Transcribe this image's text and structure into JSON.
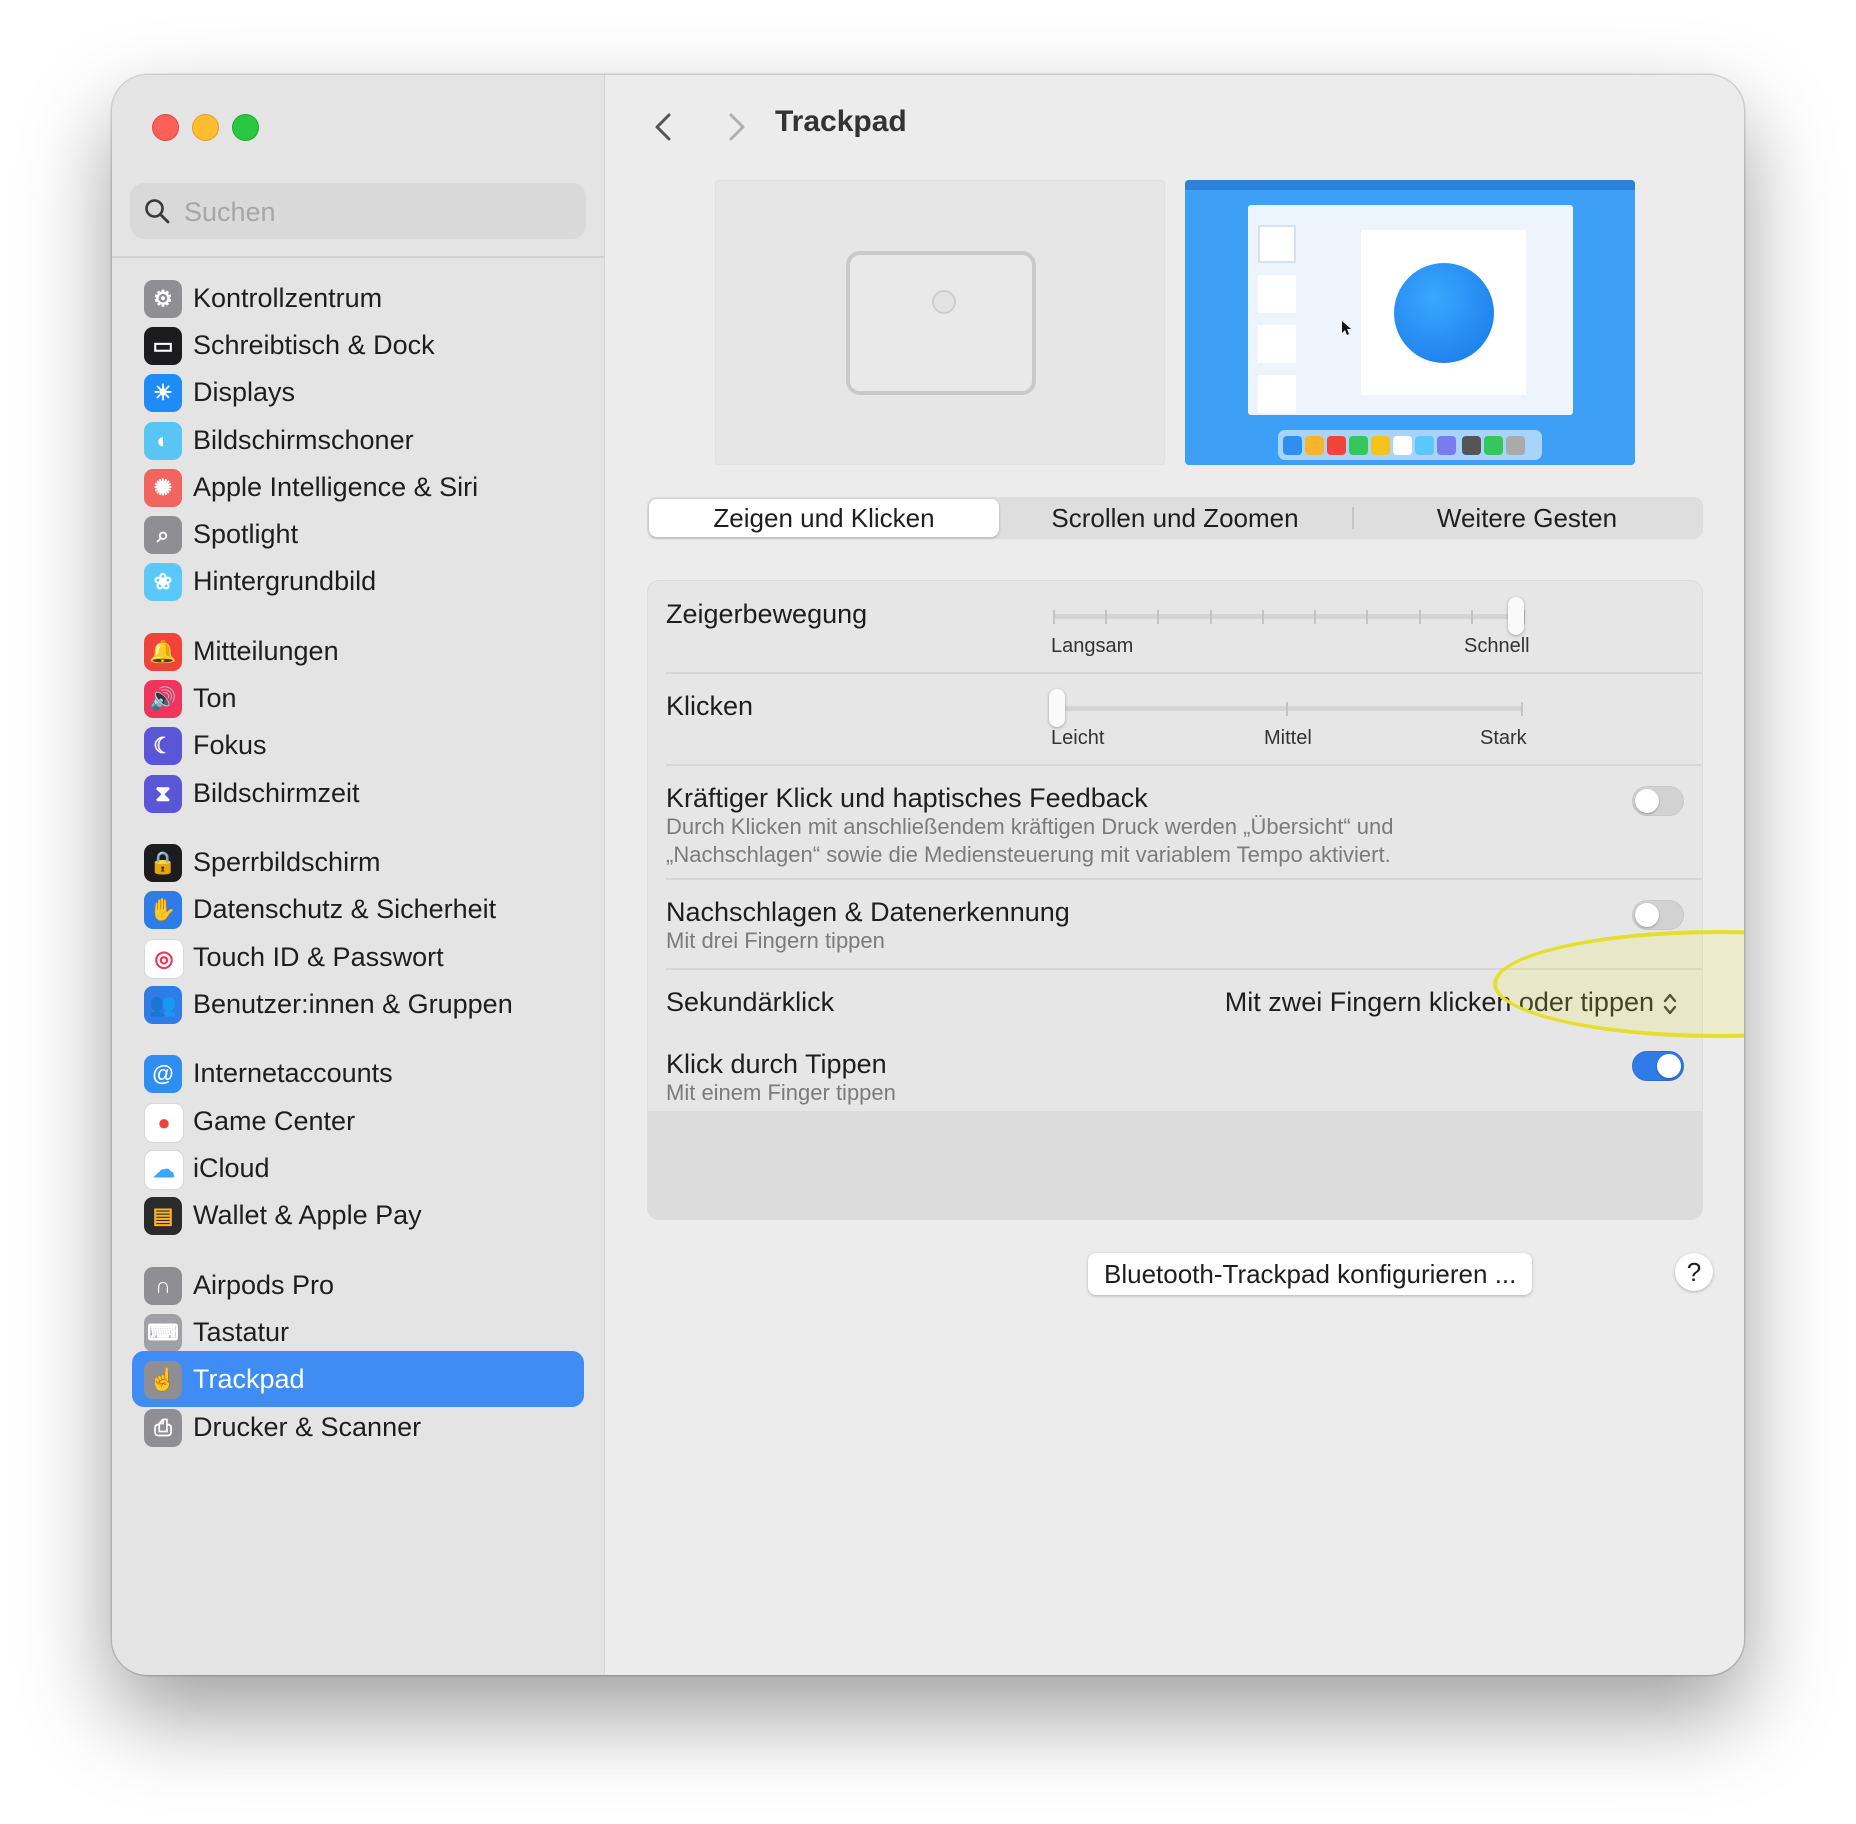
{
  "window": {
    "title": "Trackpad"
  },
  "search": {
    "placeholder": "Suchen",
    "value": ""
  },
  "sidebar": {
    "items": [
      {
        "label": "Kontrollzentrum",
        "icon": "control-center-icon",
        "color": "#8e8e93"
      },
      {
        "label": "Schreibtisch & Dock",
        "icon": "desktop-dock-icon",
        "color": "#1c1c1e"
      },
      {
        "label": "Displays",
        "icon": "displays-icon",
        "color": "#1e8bf7"
      },
      {
        "label": "Bildschirmschoner",
        "icon": "screensaver-icon",
        "color": "#58c5f5"
      },
      {
        "label": "Apple Intelligence & Siri",
        "icon": "siri-icon",
        "color": "#f2655f"
      },
      {
        "label": "Spotlight",
        "icon": "spotlight-icon",
        "color": "#8e8e93"
      },
      {
        "label": "Hintergrundbild",
        "icon": "wallpaper-icon",
        "color": "#5ac8fa"
      },
      {
        "label": "Mitteilungen",
        "icon": "notifications-icon",
        "color": "#f0443a"
      },
      {
        "label": "Ton",
        "icon": "sound-icon",
        "color": "#f0355c"
      },
      {
        "label": "Fokus",
        "icon": "focus-icon",
        "color": "#5a56d6"
      },
      {
        "label": "Bildschirmzeit",
        "icon": "screen-time-icon",
        "color": "#5a56d6"
      },
      {
        "label": "Sperrbildschirm",
        "icon": "lock-screen-icon",
        "color": "#1c1c1e"
      },
      {
        "label": "Datenschutz & Sicherheit",
        "icon": "privacy-hand-icon",
        "color": "#2f7ce8"
      },
      {
        "label": "Touch ID & Passwort",
        "icon": "fingerprint-icon",
        "color": "#ffffff"
      },
      {
        "label": "Benutzer:innen & Gruppen",
        "icon": "users-icon",
        "color": "#2f7ce8"
      },
      {
        "label": "Internetaccounts",
        "icon": "at-icon",
        "color": "#2f8ef0"
      },
      {
        "label": "Game Center",
        "icon": "game-center-icon",
        "color": "#ffffff"
      },
      {
        "label": "iCloud",
        "icon": "icloud-icon",
        "color": "#ffffff"
      },
      {
        "label": "Wallet & Apple Pay",
        "icon": "wallet-icon",
        "color": "#2b2b2b"
      },
      {
        "label": "Airpods Pro",
        "icon": "airpods-icon",
        "color": "#8e8e93"
      },
      {
        "label": "Tastatur",
        "icon": "keyboard-icon",
        "color": "#a0a0a5"
      },
      {
        "label": "Trackpad",
        "icon": "trackpad-icon",
        "color": "#8e8e93",
        "selected": true
      },
      {
        "label": "Drucker & Scanner",
        "icon": "printer-icon",
        "color": "#8e8e93"
      }
    ]
  },
  "tabs": [
    "Zeigen und Klicken",
    "Scrollen und Zoomen",
    "Weitere Gesten"
  ],
  "active_tab": "Zeigen und Klicken",
  "settings": {
    "pointer_speed": {
      "title": "Zeigerbewegung",
      "min_label": "Langsam",
      "max_label": "Schnell",
      "value_fraction": 1.0,
      "steps": 10
    },
    "click_force": {
      "title": "Klicken",
      "labels": [
        "Leicht",
        "Mittel",
        "Stark"
      ],
      "value_fraction": 0.0
    },
    "force_click": {
      "title": "Kräftiger Klick und haptisches Feedback",
      "sub_line1": "Durch Klicken mit anschließendem kräftigen Druck werden „Übersicht“ und",
      "sub_line2": "„Nachschlagen“ sowie die Mediensteuerung mit variablem Tempo aktiviert.",
      "enabled": false
    },
    "lookup": {
      "title": "Nachschlagen & Datenerkennung",
      "subtitle": "Mit drei Fingern tippen",
      "enabled": false
    },
    "secondary_click": {
      "title": "Sekundärklick",
      "value": "Mit zwei Fingern klicken oder tippen"
    },
    "tap_to_click": {
      "title": "Klick durch Tippen",
      "subtitle": "Mit einem Finger tippen",
      "enabled": true
    }
  },
  "buttons": {
    "bluetooth": "Bluetooth-Trackpad konfigurieren ...",
    "help": "?"
  },
  "colors": {
    "accent": "#3f8cf5",
    "annotation": "#e4df2a",
    "toggle_on": "#2f7ce8"
  }
}
